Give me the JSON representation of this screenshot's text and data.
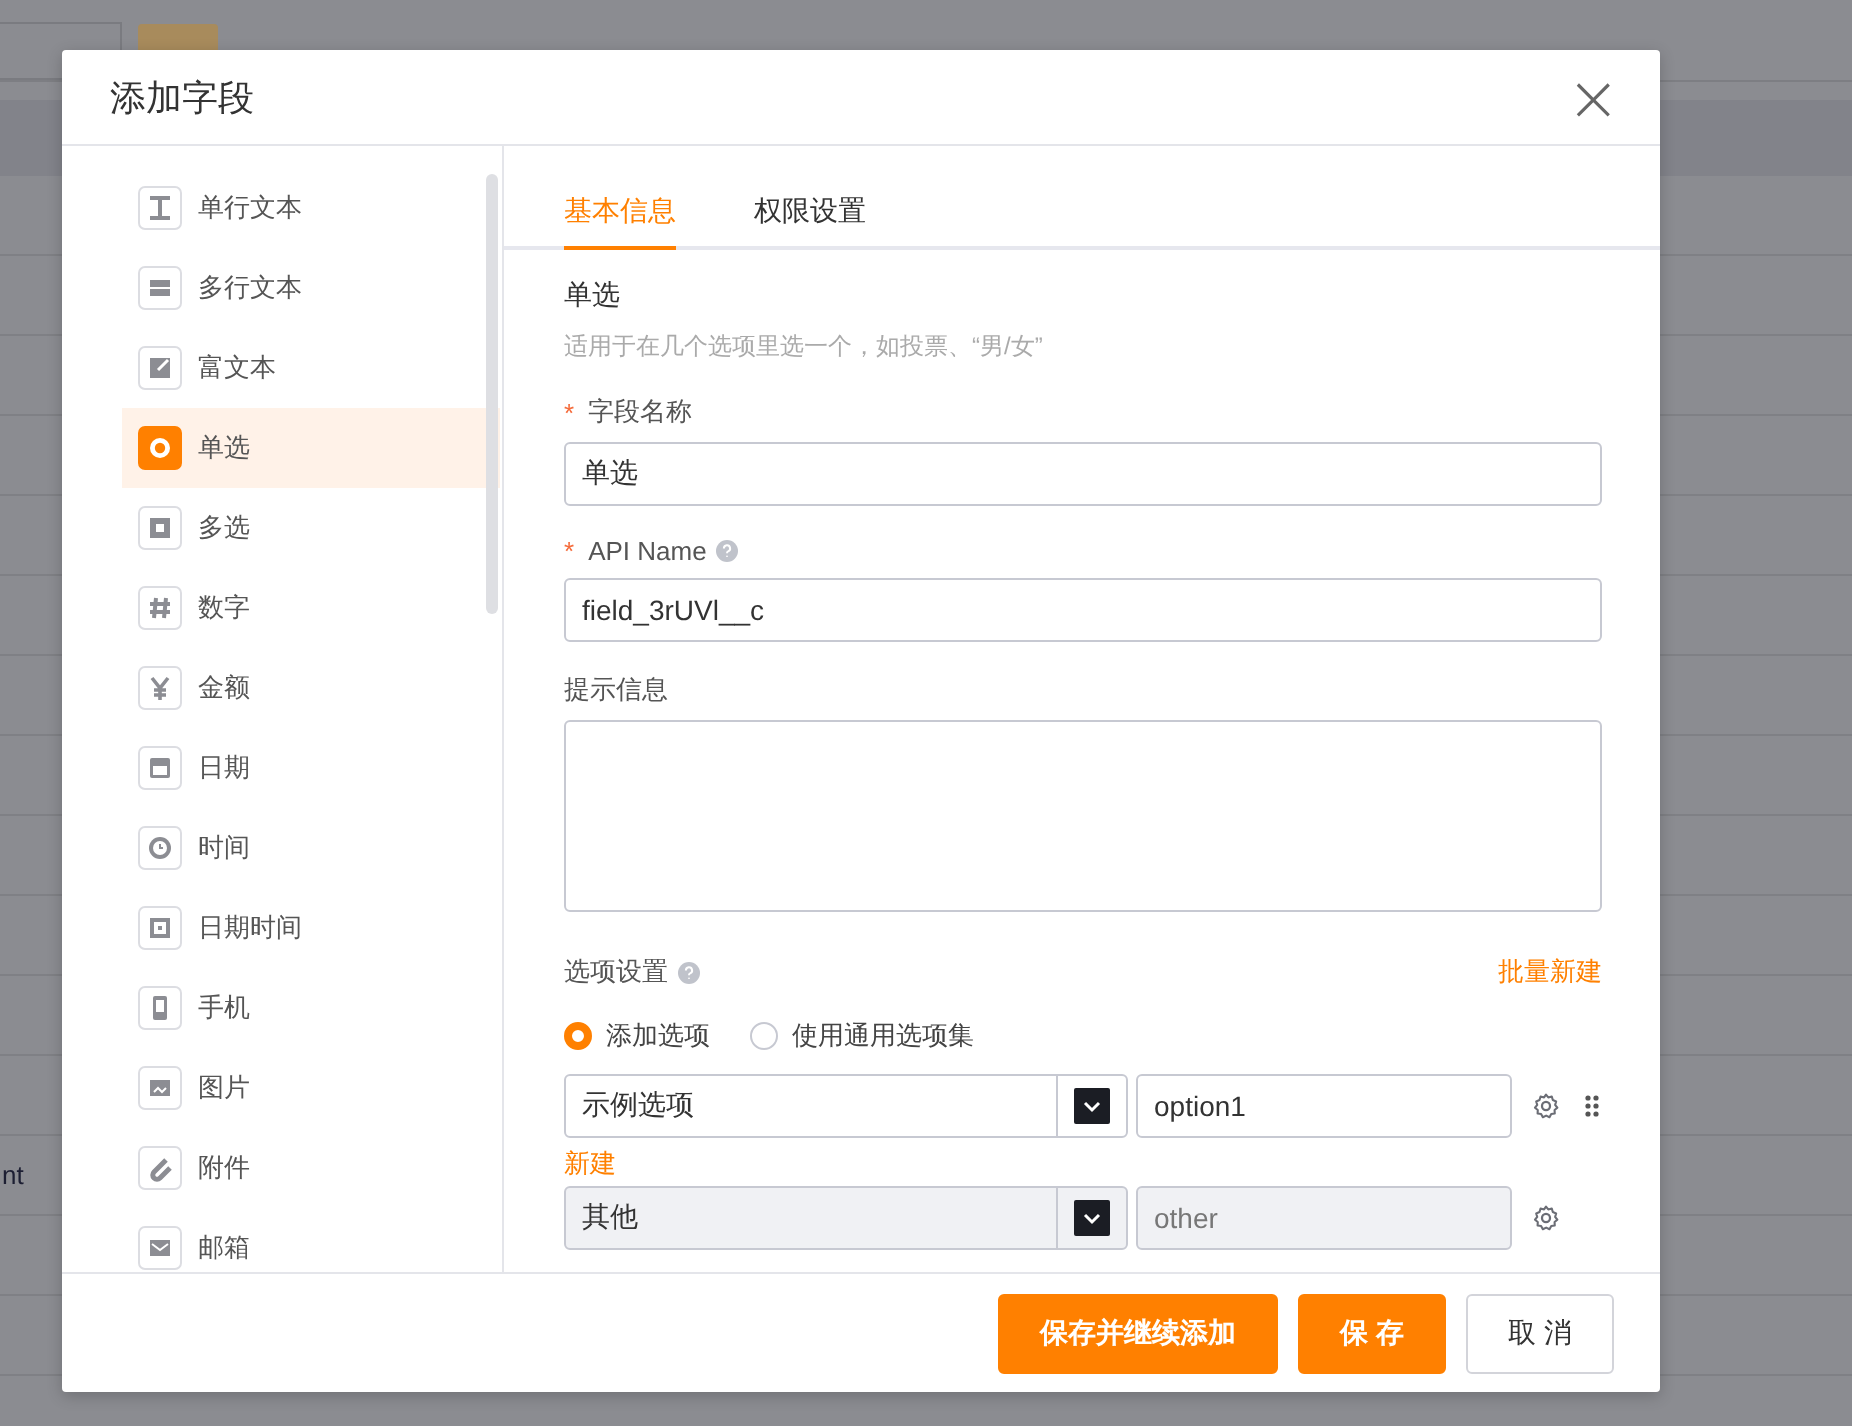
{
  "background": {
    "text": "nt"
  },
  "dialog": {
    "title": "添加字段",
    "close": "×"
  },
  "sidebar": {
    "items": [
      {
        "label": "单行文本",
        "kind": "text",
        "selected": false
      },
      {
        "label": "多行文本",
        "kind": "textarea",
        "selected": false
      },
      {
        "label": "富文本",
        "kind": "richtext",
        "selected": false
      },
      {
        "label": "单选",
        "kind": "radio",
        "selected": true
      },
      {
        "label": "多选",
        "kind": "checkbox",
        "selected": false
      },
      {
        "label": "数字",
        "kind": "number",
        "selected": false
      },
      {
        "label": "金额",
        "kind": "currency",
        "selected": false
      },
      {
        "label": "日期",
        "kind": "date",
        "selected": false
      },
      {
        "label": "时间",
        "kind": "time",
        "selected": false
      },
      {
        "label": "日期时间",
        "kind": "datetime",
        "selected": false
      },
      {
        "label": "手机",
        "kind": "phone",
        "selected": false
      },
      {
        "label": "图片",
        "kind": "image",
        "selected": false
      },
      {
        "label": "附件",
        "kind": "attachment",
        "selected": false
      },
      {
        "label": "邮箱",
        "kind": "email",
        "selected": false
      }
    ]
  },
  "tabs": [
    {
      "label": "基本信息",
      "selected": true
    },
    {
      "label": "权限设置",
      "selected": false
    }
  ],
  "form": {
    "required_mark": "*",
    "type_title": "单选",
    "type_description": "适用于在几个选项里选一个，如投票、“男/女”",
    "fields": [
      {
        "label": "字段名称",
        "required": true,
        "help": false,
        "kind": "input",
        "value": "单选"
      },
      {
        "label": "API Name",
        "required": true,
        "help": true,
        "kind": "input",
        "value": "field_3rUVl__c"
      },
      {
        "label": "提示信息",
        "required": false,
        "help": false,
        "kind": "textarea"
      }
    ],
    "options_label": "选项设置",
    "batch_create": "批量新建",
    "option_sources": [
      {
        "label": "添加选项",
        "selected": true
      },
      {
        "label": "使用通用选项集",
        "selected": false
      }
    ],
    "options": [
      {
        "label": "示例选项",
        "value": "option1",
        "disabled": false,
        "draggable": true
      },
      {
        "label": "其他",
        "value": "other",
        "disabled": true,
        "draggable": false
      }
    ],
    "new_option": "新建"
  },
  "footer": {
    "buttons": [
      {
        "label": "保存并继续添加",
        "kind": "primary"
      },
      {
        "label": "保 存",
        "kind": "primary"
      },
      {
        "label": "取 消",
        "kind": "default"
      }
    ]
  }
}
